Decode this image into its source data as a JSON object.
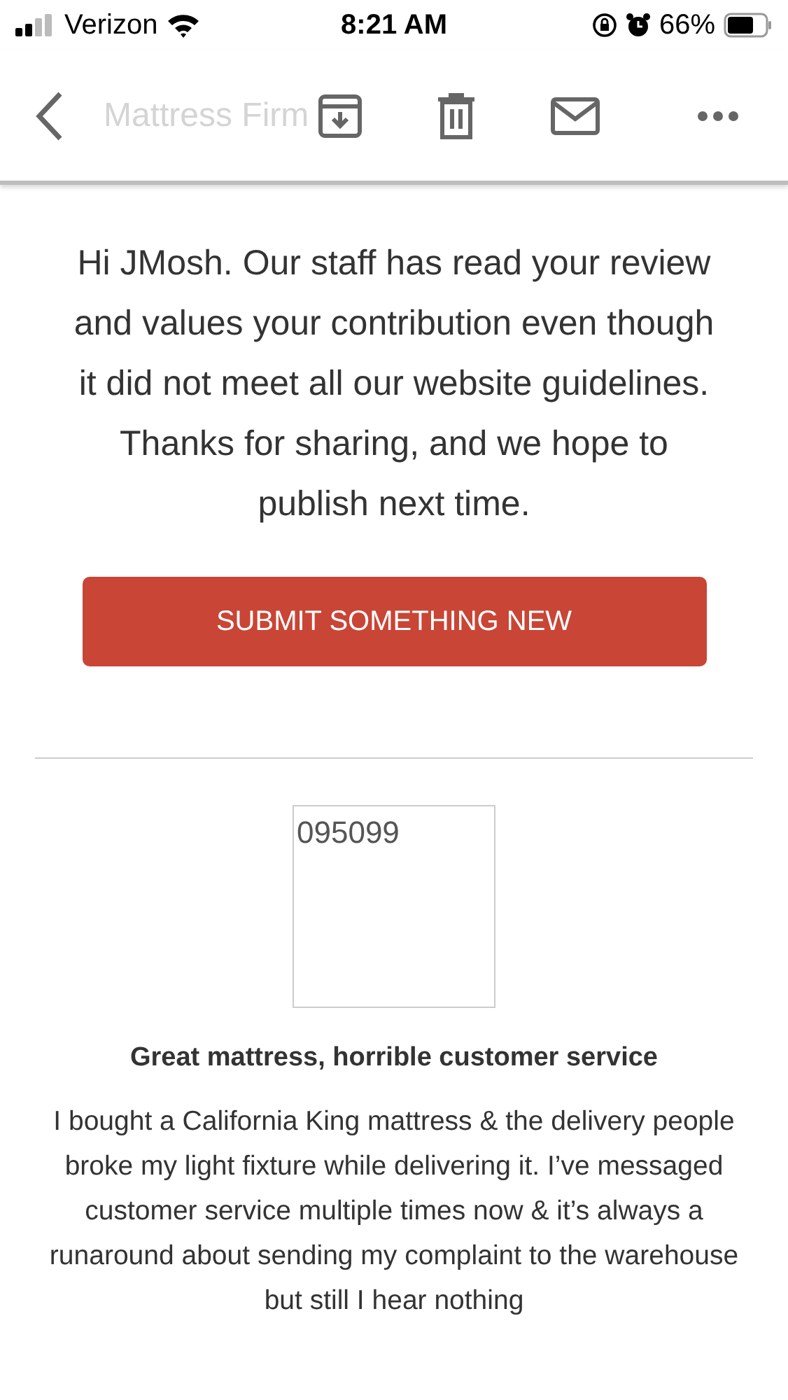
{
  "status_bar": {
    "carrier": "Verizon",
    "time": "8:21 AM",
    "battery": "66%"
  },
  "toolbar": {
    "title": "Mattress Firm"
  },
  "message": "Hi JMosh. Our staff has read your review and values your contribution even though it did not meet all our website guidelines. Thanks for sharing, and we hope to publish next time.",
  "button": "SUBMIT SOMETHING NEW",
  "review": {
    "image_alt": "095099",
    "title": "Great mattress, horrible customer service",
    "text": "I bought a California King mattress & the delivery people broke my light fixture while delivering it. I’ve messaged customer service multiple times now & it’s always a runaround about sending my complaint to the warehouse but still I hear nothing"
  }
}
